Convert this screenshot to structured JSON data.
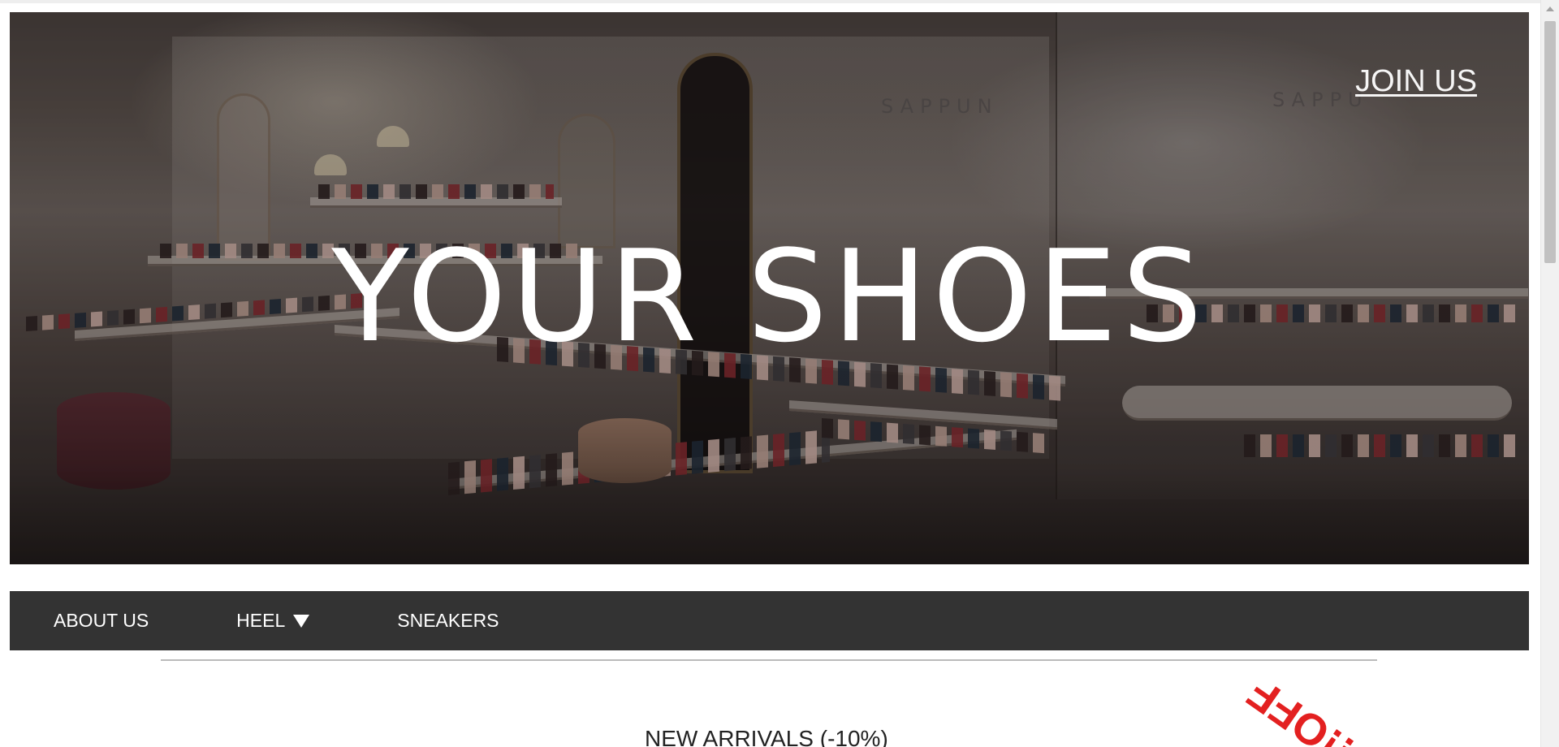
{
  "hero": {
    "title": "YOUR SHOES",
    "join_label": "JOIN US",
    "brand_sign": "SAPPUN",
    "brand_sign_partial": "SAPPU",
    "image_description": "shoe store interior"
  },
  "nav": {
    "items": [
      {
        "label": "ABOUT US"
      },
      {
        "label": "HEEL",
        "dropdown_icon": "caret-down-icon"
      },
      {
        "label": "SNEAKERS"
      }
    ]
  },
  "main": {
    "section_title": "NEW ARRIVALS (-10%)",
    "promo_stamp": "!!OFF",
    "promo_color": "#e32020"
  },
  "colors": {
    "navbar_bg": "#333333",
    "nav_text": "#ffffff",
    "page_bg": "#ffffff"
  }
}
